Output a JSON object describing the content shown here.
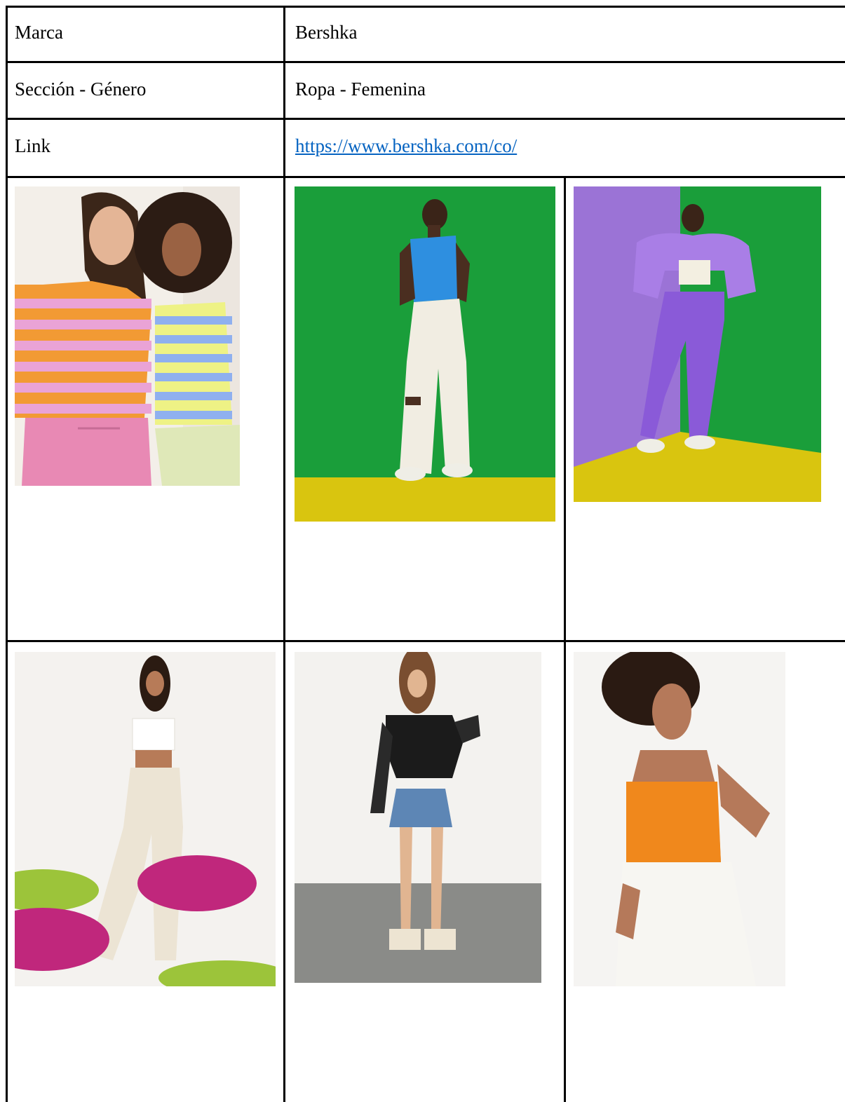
{
  "table": {
    "rows": [
      {
        "label": "Marca",
        "value": "Bershka"
      },
      {
        "label": "Sección - Género",
        "value": "Ropa - Femenina"
      },
      {
        "label": "Link",
        "value": "https://www.bershka.com/co/",
        "is_link": true
      }
    ]
  },
  "colors": {
    "border": "#000000",
    "link": "#0563c1",
    "green_backdrop": "#1a9e3a",
    "yellow_floor": "#d9c50f",
    "purple_wall": "#9b73d6"
  },
  "photos": [
    {
      "icon": "photo-striped-sweaters"
    },
    {
      "icon": "photo-blue-top-white-jeans"
    },
    {
      "icon": "photo-purple-denim-set"
    },
    {
      "icon": "photo-white-top-beige-trousers"
    },
    {
      "icon": "photo-black-blouse-denim-skirt"
    },
    {
      "icon": "photo-orange-top-white-jeans"
    }
  ]
}
